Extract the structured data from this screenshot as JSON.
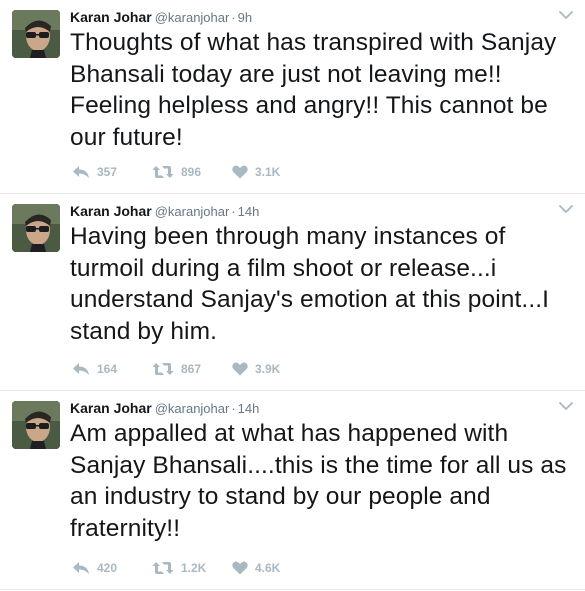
{
  "tweets": [
    {
      "fullname": "Karan Johar",
      "username": "@karanjohar",
      "separator": "·",
      "time": "9h",
      "text": "Thoughts of what has transpired with Sanjay Bhansali today are just not leaving me!! Feeling helpless and angry!! This cannot be our future!",
      "replies": "357",
      "retweets": "896",
      "likes": "3.1K"
    },
    {
      "fullname": "Karan Johar",
      "username": "@karanjohar",
      "separator": "·",
      "time": "14h",
      "text": "Having been through many instances of turmoil during a film shoot or release...i understand Sanjay's emotion at this point...I stand by him.",
      "replies": "164",
      "retweets": "867",
      "likes": "3.9K"
    },
    {
      "fullname": "Karan Johar",
      "username": "@karanjohar",
      "separator": "·",
      "time": "14h",
      "text": "Am appalled at what has happened with Sanjay Bhansali....this is the time  for all us as an industry to stand by our people and fraternity!!",
      "replies": "420",
      "retweets": "1.2K",
      "likes": "4.6K"
    }
  ],
  "icons": {
    "reply": "reply-icon",
    "retweet": "retweet-icon",
    "like": "heart-icon",
    "menu": "chevron-down-icon",
    "avatar": "avatar-photo"
  },
  "colors": {
    "text": "#14171a",
    "muted": "#657786",
    "action": "#aab8c2",
    "divider": "#e6ecf0"
  }
}
